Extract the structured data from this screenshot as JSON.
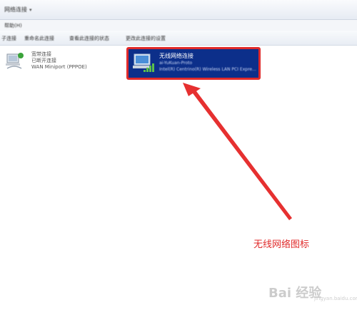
{
  "window": {
    "breadcrumb": "网络连接",
    "chevron": "▾"
  },
  "menubar": {
    "items": [
      "帮助(H)"
    ]
  },
  "toolbar": {
    "buttons": [
      "子连接",
      "重命名此连接",
      "查看此连接的状态",
      "更改此连接的设置"
    ]
  },
  "connections": [
    {
      "name": "宽带连接",
      "status": "已断开连接",
      "adapter": "WAN Miniport (PPPOE)",
      "selected": false
    },
    {
      "name": "无线网络连接",
      "network": "ai-YuKuan-Proto",
      "adapter": "Intel(R) Centrino(R) Wireless LAN PCI Expre...",
      "selected": true
    }
  ],
  "annotation": {
    "text": "无线网络图标",
    "color": "#e02a2a"
  },
  "watermark": {
    "text": "Bai 经验",
    "sub": "jingyan.baidu.com"
  },
  "colors": {
    "selection_bg": "#0c2f8a",
    "highlight_border": "#e02a2a"
  }
}
